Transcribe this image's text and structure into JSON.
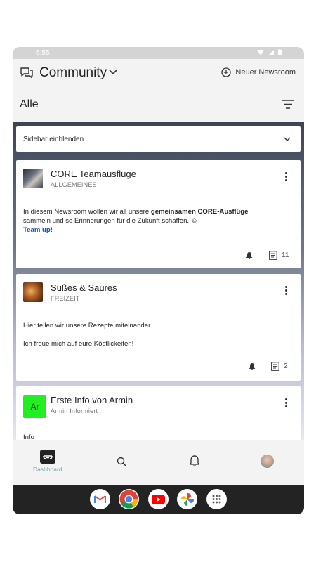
{
  "status": {
    "time": "5:55"
  },
  "header": {
    "title": "Community",
    "new_newsroom_label": "Neuer Newsroom"
  },
  "filter": {
    "label": "Alle"
  },
  "sidebar_toggle": {
    "label": "Sidebar einblenden"
  },
  "posts": [
    {
      "title": "CORE Teamausflüge",
      "category": "ALLGEMEINES",
      "body_part1": "In diesem Newsroom wollen wir all unsere ",
      "body_bold": "gemeinsamen CORE-Ausflüge",
      "body_part2": "sammeln und so Erinnerungen für die Zukunft schaffen. ☺",
      "link": "Team up!",
      "count": "11"
    },
    {
      "title": "Süßes & Saures",
      "category": "FREIZEIT",
      "line1": "Hier teilen wir unsere Rezepte miteinander.",
      "line2": "Ich freue mich auf eure Köstlickeiten!",
      "count": "2"
    },
    {
      "title": "Erste Info von Armin",
      "subtitle": "Armin Informiert",
      "avatar_initials": "Ar",
      "body": "Info"
    }
  ],
  "nav": {
    "dashboard_label": "Dashboard"
  },
  "colors": {
    "accent": "#6aa3ad",
    "link": "#1a55a8",
    "avatar_green": "#22ee22",
    "dock": "#232323"
  },
  "icons": [
    "chat-bubbles-icon",
    "chevron-down-icon",
    "plus-circle-icon",
    "filter-icon",
    "more-vert-icon",
    "bell-icon",
    "document-icon",
    "search-icon",
    "profile-avatar-icon",
    "gmail-icon",
    "chrome-icon",
    "youtube-icon",
    "photos-icon",
    "app-drawer-icon"
  ]
}
